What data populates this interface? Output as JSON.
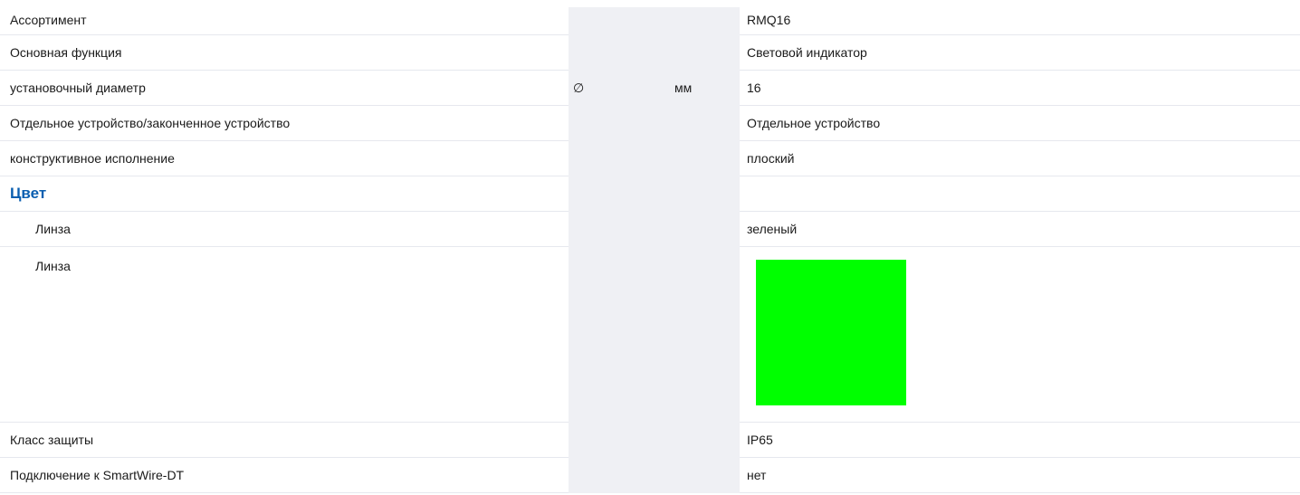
{
  "colors": {
    "section_heading": "#0a5eb0",
    "unit_column_bg": "#eff0f4",
    "lens_swatch": "#00ff00"
  },
  "rows": [
    {
      "label": "Ассортимент",
      "symbol": "",
      "unit": "",
      "value": "RMQ16"
    },
    {
      "label": "Основная функция",
      "symbol": "",
      "unit": "",
      "value": "Световой индикатор"
    },
    {
      "label": "установочный диаметр",
      "symbol": "∅",
      "unit": "мм",
      "value": "16"
    },
    {
      "label": "Отдельное устройство/законченное устройство",
      "symbol": "",
      "unit": "",
      "value": "Отдельное устройство"
    },
    {
      "label": "конструктивное исполнение",
      "symbol": "",
      "unit": "",
      "value": "плоский"
    }
  ],
  "color_section": {
    "heading": "Цвет",
    "lens_text_row": {
      "label": "Линза",
      "value": "зеленый"
    },
    "lens_swatch_row": {
      "label": "Линза",
      "swatch_color": "#00ff00"
    }
  },
  "rows_after": [
    {
      "label": "Класс защиты",
      "symbol": "",
      "unit": "",
      "value": "IP65"
    },
    {
      "label": "Подключение к SmartWire-DT",
      "symbol": "",
      "unit": "",
      "value": "нет"
    }
  ]
}
